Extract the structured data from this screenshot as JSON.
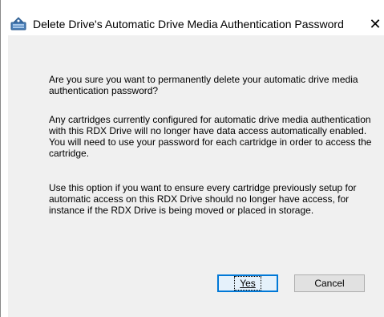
{
  "window": {
    "title": "Delete Drive's Automatic Drive Media Authentication Password",
    "app_icon": "rdx-drive-icon",
    "close_icon": "close-icon",
    "close_glyph": "✕"
  },
  "dialog": {
    "message1": "Are you sure you want to permanently delete your automatic drive media authentication password?",
    "message2": "Any cartridges currently configured for automatic drive media authentication with this RDX Drive will no longer have data access automatically enabled. You will need to use your password for each cartridge in order to access the cartridge.",
    "message3": "Use this option if you want to ensure every cartridge previously setup for automatic access on this RDX Drive should no longer have access, for instance if the RDX Drive is being moved or placed in storage.",
    "yes_label": "Yes",
    "cancel_label": "Cancel",
    "accent_color": "#0078d7"
  }
}
